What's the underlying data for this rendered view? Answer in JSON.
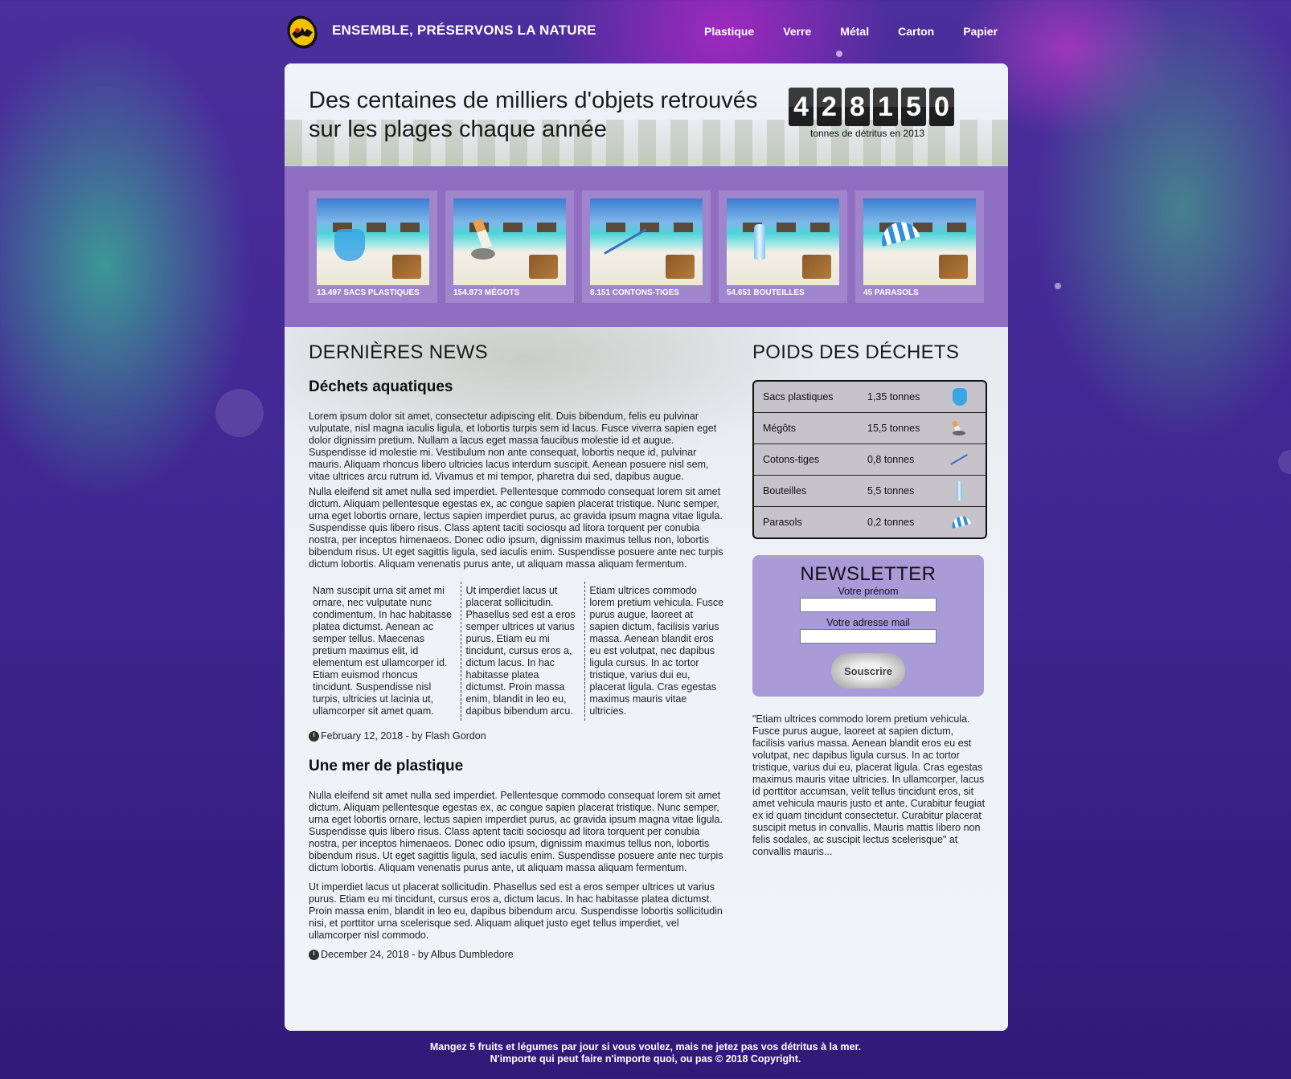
{
  "header": {
    "site_title": "ENSEMBLE, PRÉSERVONS LA NATURE",
    "nav": [
      "Plastique",
      "Verre",
      "Métal",
      "Carton",
      "Papier"
    ]
  },
  "hero": {
    "title": "Des centaines de milliers d'objets retrouvés sur les plages chaque année",
    "counter_digits": [
      "4",
      "2",
      "8",
      "1",
      "5",
      "0"
    ],
    "counter_caption": "tonnes de détritus en 2013"
  },
  "cards": [
    {
      "caption": "13.497 SACS PLASTIQUES"
    },
    {
      "caption": "154.873 MÉGOTS"
    },
    {
      "caption": "8.151 CONTONS-TIGES"
    },
    {
      "caption": "54.651 BOUTEILLES"
    },
    {
      "caption": "45 PARASOLS"
    }
  ],
  "news": {
    "heading": "DERNIÈRES NEWS",
    "articles": [
      {
        "title": "Déchets aquatiques",
        "p1": "Lorem ipsum dolor sit amet, consectetur adipiscing elit. Duis bibendum, felis eu pulvinar vulputate, nisl magna iaculis ligula, et lobortis turpis sem id lacus. Fusce viverra sapien eget dolor dignissim pretium. Nullam a lacus eget massa faucibus molestie id et augue. Suspendisse id molestie mi. Vestibulum non ante consequat, lobortis neque id, pulvinar mauris. Aliquam rhoncus libero ultricies lacus interdum suscipit. Aenean posuere nisl sem, vitae ultrices arcu rutrum id. Vivamus et mi tempor, pharetra dui sed, dapibus augue.",
        "p2": "Nulla eleifend sit amet nulla sed imperdiet. Pellentesque commodo consequat lorem sit amet dictum. Aliquam pellentesque egestas ex, ac congue sapien placerat tristique. Nunc semper, urna eget lobortis ornare, lectus sapien imperdiet purus, ac gravida ipsum magna vitae ligula. Suspendisse quis libero risus. Class aptent taciti sociosqu ad litora torquent per conubia nostra, per inceptos himenaeos. Donec odio ipsum, dignissim maximus tellus non, lobortis bibendum risus. Ut eget sagittis ligula, sed iaculis enim. Suspendisse posuere ante nec turpis dictum lobortis. Aliquam venenatis purus ante, ut aliquam massa aliquam fermentum.",
        "col1": "Nam suscipit urna sit amet mi ornare, nec vulputate nunc condimentum. In hac habitasse platea dictumst. Aenean ac semper tellus. Maecenas pretium maximus elit, id elementum est ullamcorper id. Etiam euismod rhoncus tincidunt. Suspendisse nisl turpis, ultricies ut lacinia ut, ullamcorper sit amet quam.",
        "col2": "Ut imperdiet lacus ut placerat sollicitudin. Phasellus sed est a eros semper ultrices ut varius purus. Etiam eu mi tincidunt, cursus eros a, dictum lacus. In hac habitasse platea dictumst. Proin massa enim, blandit in leo eu, dapibus bibendum arcu.",
        "col3": "Etiam ultrices commodo lorem pretium vehicula. Fusce purus augue, laoreet at sapien dictum, facilisis varius massa. Aenean blandit eros eu est volutpat, nec dapibus ligula cursus. In ac tortor tristique, varius dui eu, placerat ligula. Cras egestas maximus mauris vitae ultricies.",
        "meta": "February 12, 2018 - by Flash Gordon"
      },
      {
        "title": "Une mer de plastique",
        "p1": "Nulla eleifend sit amet nulla sed imperdiet. Pellentesque commodo consequat lorem sit amet dictum. Aliquam pellentesque egestas ex, ac congue sapien placerat tristique. Nunc semper, urna eget lobortis ornare, lectus sapien imperdiet purus, ac gravida ipsum magna vitae ligula. Suspendisse quis libero risus. Class aptent taciti sociosqu ad litora torquent per conubia nostra, per inceptos himenaeos. Donec odio ipsum, dignissim maximus tellus non, lobortis bibendum risus. Ut eget sagittis ligula, sed iaculis enim. Suspendisse posuere ante nec turpis dictum lobortis. Aliquam venenatis purus ante, ut aliquam massa aliquam fermentum.",
        "p2": "Ut imperdiet lacus ut placerat sollicitudin. Phasellus sed est a eros semper ultrices ut varius purus. Etiam eu mi tincidunt, cursus eros a, dictum lacus. In hac habitasse platea dictumst. Proin massa enim, blandit in leo eu, dapibus bibendum arcu. Suspendisse lobortis sollicitudin nisi, et porttitor urna scelerisque sed. Aliquam aliquet justo eget tellus imperdiet, vel ullamcorper nisl commodo.",
        "meta": "December 24, 2018 - by Albus Dumbledore"
      }
    ]
  },
  "weights": {
    "heading": "POIDS DES DÉCHETS",
    "rows": [
      {
        "name": "Sacs plastiques",
        "value": "1,35 tonnes",
        "icon": "plastic-bag-icon"
      },
      {
        "name": "Mégôts",
        "value": "15,5 tonnes",
        "icon": "cigarette-icon"
      },
      {
        "name": "Cotons-tiges",
        "value": "0,8 tonnes",
        "icon": "cotton-swab-icon"
      },
      {
        "name": "Bouteilles",
        "value": "5,5 tonnes",
        "icon": "bottle-icon"
      },
      {
        "name": "Parasols",
        "value": "0,2 tonnes",
        "icon": "parasol-icon"
      }
    ]
  },
  "newsletter": {
    "title": "NEWSLETTER",
    "firstname_label": "Votre prénom",
    "email_label": "Votre adresse mail",
    "firstname_value": "",
    "email_value": "",
    "button": "Souscrire"
  },
  "quote": "\"Etiam ultrices commodo lorem pretium vehicula. Fusce purus augue, laoreet at sapien dictum, facilisis varius massa. Aenean blandit eros eu est volutpat, nec dapibus ligula cursus. In ac tortor tristique, varius dui eu, placerat ligula. Cras egestas maximus mauris vitae ultricies. In ullamcorper, lacus id porttitor accumsan, velit tellus tincidunt eros, sit amet vehicula mauris justo et ante. Curabitur feugiat ex id quam tincidunt consectetur. Curabitur placerat suscipit metus in convallis. Mauris mattis libero non felis sodales, ac suscipit lectus scelerisque\" at convallis mauris...",
  "footer": {
    "line1": "Mangez 5 fruits et légumes par jour si vous voulez, mais ne jetez pas vos détritus à la mer.",
    "line2": "N'importe qui peut faire n'importe quoi, ou pas © 2018 Copyright."
  }
}
